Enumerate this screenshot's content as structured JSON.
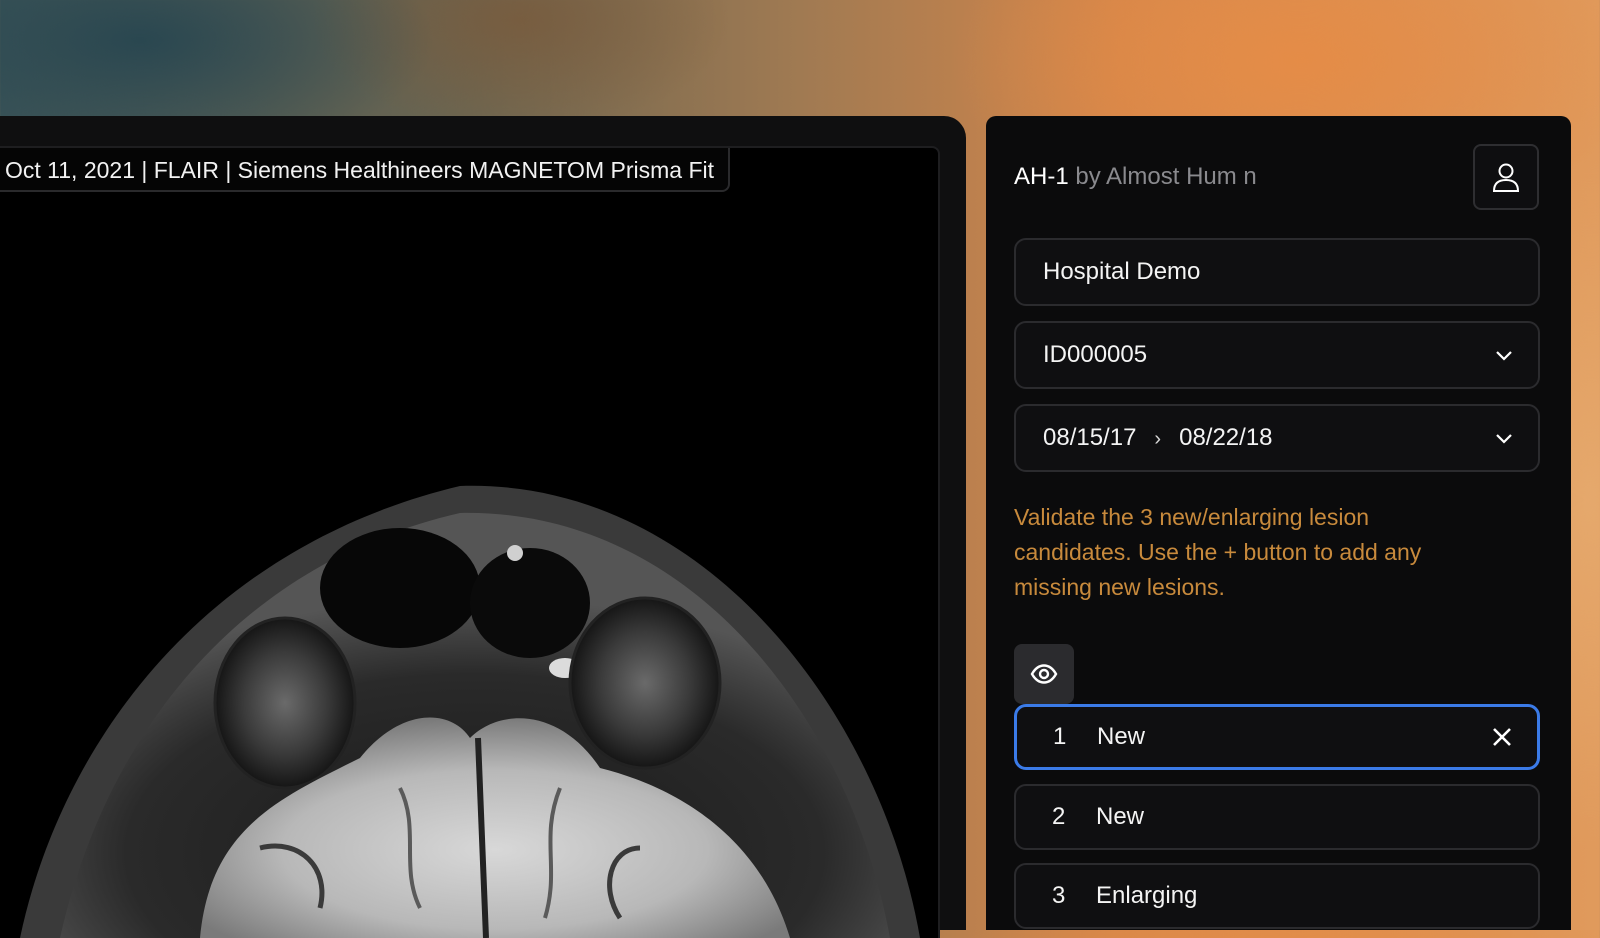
{
  "scan_header": "Oct 11, 2021 | FLAIR | Siemens Healthineers MAGNETOM Prisma Fit",
  "panel": {
    "model": "AH-1",
    "by_text": "by Almost Hum n",
    "user_icon": "user-icon",
    "hospital": "Hospital Demo",
    "patient_id": "ID000005",
    "date_from": "08/15/17",
    "date_separator": "›",
    "date_to": "08/22/18",
    "instructions": "Validate the 3 new/enlarging lesion candidates. Use the + button to add any missing new lesions.",
    "eye_icon": "eye-icon"
  },
  "lesions": [
    {
      "num": "1",
      "label": "New",
      "active": true
    },
    {
      "num": "2",
      "label": "New",
      "active": false
    },
    {
      "num": "3",
      "label": "Enlarging",
      "active": false
    }
  ],
  "colors": {
    "accent": "#3b7be8",
    "instruction_text": "#c88a3c"
  }
}
